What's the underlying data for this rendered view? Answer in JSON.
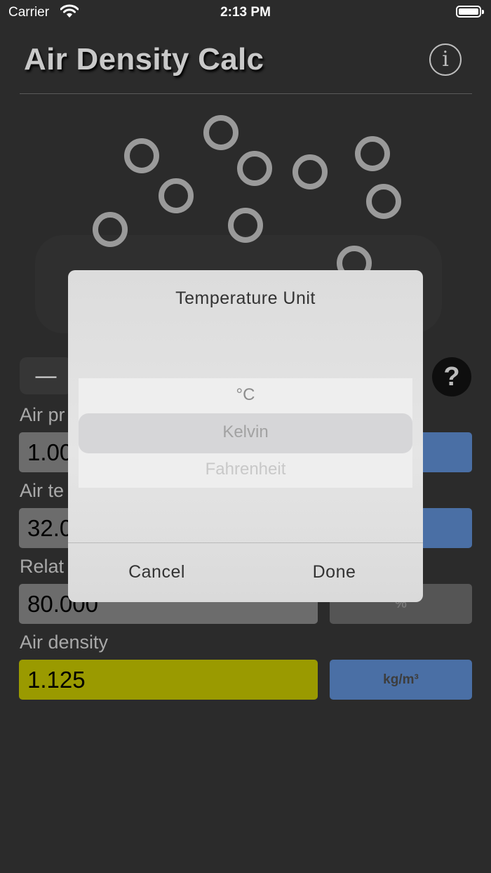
{
  "status_bar": {
    "carrier": "Carrier",
    "time": "2:13 PM"
  },
  "header": {
    "title": "Air Density Calc",
    "info_glyph": "i"
  },
  "controls": {
    "minus_glyph": "—",
    "help_glyph": "?"
  },
  "fields": {
    "pressure": {
      "label": "Air pr",
      "value": "1.00",
      "unit": ""
    },
    "temperature": {
      "label": "Air te",
      "value": "32.0",
      "unit": ""
    },
    "humidity": {
      "label": "Relat",
      "value": "80.000",
      "unit": "%"
    },
    "density": {
      "label": "Air density",
      "value": "1.125",
      "unit": "kg/m³"
    }
  },
  "dialog": {
    "title": "Temperature Unit",
    "options": [
      "°C",
      "Kelvin",
      "Fahrenheit"
    ],
    "selected": "Kelvin",
    "cancel_label": "Cancel",
    "done_label": "Done"
  },
  "colors": {
    "accent_blue": "#4a6fa5",
    "density_field": "#9a9a00",
    "background": "#2b2b2b"
  },
  "icons": [
    "wifi-icon",
    "battery-icon",
    "info-icon",
    "help-icon",
    "molecule-icon"
  ]
}
